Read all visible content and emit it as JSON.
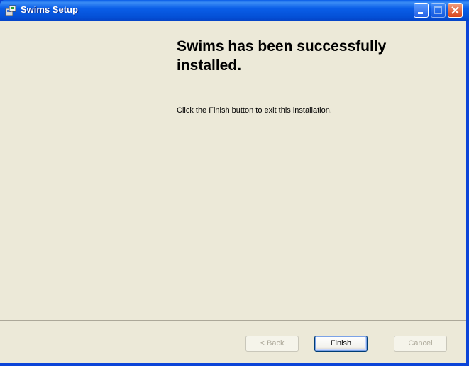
{
  "window": {
    "title": "Swims Setup"
  },
  "titlebar": {
    "buttons": [
      "minimize",
      "maximize",
      "close"
    ]
  },
  "content": {
    "heading": "Swims has been successfully installed.",
    "message": "Click the Finish button to exit this installation."
  },
  "buttons": {
    "back": "< Back",
    "finish": "Finish",
    "cancel": "Cancel"
  },
  "icons": {
    "app": "installer-icon",
    "minimize": "minimize-icon",
    "maximize": "maximize-icon",
    "close": "close-icon"
  },
  "colors": {
    "titlebar": "#0a5ee8",
    "client_background": "#ece9d8",
    "close_button": "#d8431b"
  }
}
